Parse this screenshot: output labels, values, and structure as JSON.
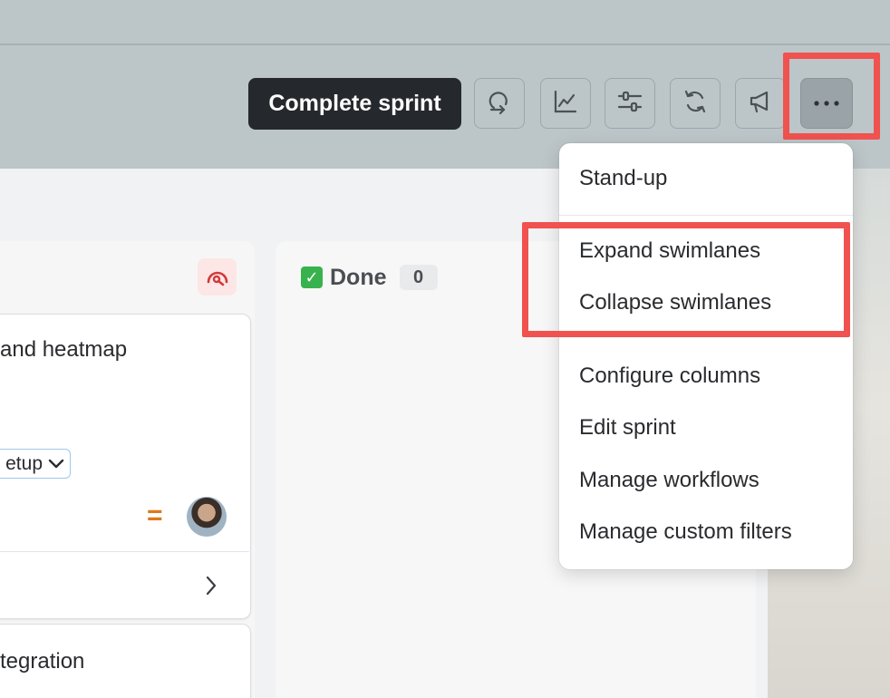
{
  "toolbar": {
    "complete_sprint_label": "Complete sprint",
    "icons": [
      "sprint-loop-icon",
      "chart-line-icon",
      "sliders-icon",
      "refresh-icon",
      "megaphone-icon",
      "more-dots-icon"
    ]
  },
  "menu": {
    "items": [
      {
        "label": "Stand-up"
      },
      {
        "label": "Expand swimlanes"
      },
      {
        "label": "Collapse swimlanes"
      },
      {
        "label": "Configure columns"
      },
      {
        "label": "Edit sprint"
      },
      {
        "label": "Manage workflows"
      },
      {
        "label": "Manage custom filters"
      }
    ]
  },
  "board": {
    "done_column": {
      "label": "Done",
      "count": "0"
    },
    "cards": [
      {
        "title_fragment": "and heatmap",
        "chip": "etup",
        "priority_symbol": "="
      },
      {
        "title_fragment": "tegration"
      }
    ]
  },
  "colors": {
    "highlight": "#f0524f",
    "complete_button_bg": "#25282c",
    "priority": "#e07818",
    "done_check": "#37b24d"
  }
}
